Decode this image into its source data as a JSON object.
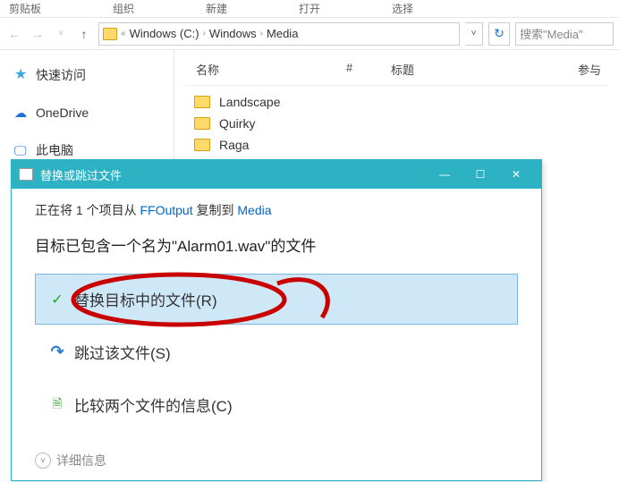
{
  "ribbon": {
    "clipboard": "剪贴板",
    "organize": "组织",
    "new": "新建",
    "open": "打开",
    "select": "选择"
  },
  "navbar": {
    "breadcrumb_prefix": "«",
    "crumb1": "Windows (C:)",
    "crumb2": "Windows",
    "crumb3": "Media",
    "search_placeholder": "搜索\"Media\""
  },
  "sidebar": {
    "quick_access": "快速访问",
    "onedrive": "OneDrive",
    "this_pc": "此电脑"
  },
  "columns": {
    "name": "名称",
    "hash": "#",
    "title": "标题",
    "participants": "参与"
  },
  "files": [
    {
      "name": "Landscape"
    },
    {
      "name": "Quirky"
    },
    {
      "name": "Raga"
    }
  ],
  "dialog": {
    "title": "替换或跳过文件",
    "status_prefix": "正在将 1 个项目从 ",
    "status_from": "FFOutput",
    "status_mid": " 复制到 ",
    "status_to": "Media",
    "conflict_prefix": "目标已包含一个名为\"",
    "conflict_file": "Alarm01.wav",
    "conflict_suffix": "\"的文件",
    "option_replace": "替换目标中的文件(R)",
    "option_skip": "跳过该文件(S)",
    "option_compare": "比较两个文件的信息(C)",
    "details": "详细信息"
  }
}
